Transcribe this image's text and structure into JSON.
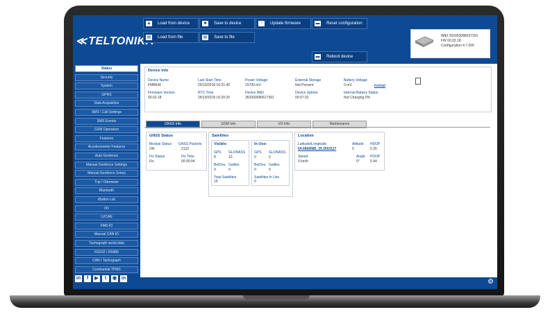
{
  "brand": {
    "name": "TELTONIKA",
    "mark": "≪"
  },
  "toolbar": {
    "load_from_device": "Load from device",
    "save_to_device": "Save to device",
    "update_firmware": "Update firmware",
    "reset_configuration": "Reset configuration",
    "load_from_file": "Load from file",
    "save_to_file": "Save to file",
    "reboot_device": "Reboot device"
  },
  "device_box": {
    "imei": "IMEI 352093088637391",
    "fw": "FW 00.02.18",
    "configuration": "Configuration 4.7.000"
  },
  "sidebar": {
    "items": [
      "Status",
      "Security",
      "System",
      "GPRS",
      "Data Acquisition",
      "SMS \\ Call Settings",
      "SMS Events",
      "GSM Operators",
      "Features",
      "Accelerometer Features",
      "Auto Geofence",
      "Manual Geofence Settings",
      "Manual Geofence Zones",
      "Trip \\ Odometer",
      "Bluetooth",
      "iButton List",
      "I/O",
      "LVCAN",
      "FMS IO",
      "Manual CAN IO",
      "Tachograph serial data",
      "RS232 \\ RS485",
      "CAN \\ Tachograph",
      "Continental TPMS"
    ],
    "social": [
      "in",
      "f",
      "▶",
      "t",
      "◉",
      "in"
    ]
  },
  "device_info": {
    "title": "Device Info",
    "fields": [
      {
        "label": "Device Name",
        "value": "FMB640"
      },
      {
        "label": "Last Start Time",
        "value": "25/10/2018 16:21:40"
      },
      {
        "label": "Power Voltage",
        "value": "15790 mV."
      },
      {
        "label": "External Storage",
        "value": "Not Present"
      },
      {
        "label": "Battery Voltage",
        "value": "0 mV."
      },
      {
        "label": "Firmware Version",
        "value": "00.02.18"
      },
      {
        "label": "RTC Time",
        "value": "25/10/2018 16:29:20"
      },
      {
        "label": "Device IMEI",
        "value": "352093080617391"
      },
      {
        "label": "Device Uptime",
        "value": "00:07:32"
      },
      {
        "label": "Internal Battery Status",
        "value": "Not Charging 0%"
      }
    ],
    "format_link": "Format"
  },
  "tabs": [
    "GNSS Info",
    "GSM Info",
    "I/O Info",
    "Maintenance"
  ],
  "gnss_status": {
    "title": "GNSS Status",
    "module_status_label": "Module Status",
    "module_status": "ON",
    "gnss_packets_label": "GNSS Packets",
    "gnss_packets": "2132",
    "fix_status_label": "Fix Status",
    "fix_status": "Fix",
    "fix_time_label": "Fix Time",
    "fix_time": "00:00:04"
  },
  "satellites": {
    "title": "Satellites",
    "visible_title": "Visible:",
    "in_use_title": "In Use:",
    "gps_label": "GPS",
    "glonass_label": "GLONASS",
    "beidou_label": "BeiDou",
    "galileo_label": "Galileo",
    "visible": {
      "gps": "8",
      "glonass": "10",
      "beidou": "0",
      "galileo": "0"
    },
    "in_use": {
      "gps": "0",
      "glonass": "0",
      "beidou": "0",
      "galileo": "0"
    },
    "total_label": "Total Satellites",
    "total": "15",
    "sats_in_use_label": "Satellites In Use",
    "sats_in_use": "0"
  },
  "location": {
    "title": "Location",
    "latlng_label": "Latitude/Longitude",
    "latlng": "54.6669585, 25.2553117",
    "altitude_label": "Altitude",
    "altitude": "0",
    "hdop_label": "HDOP",
    "hdop": "5.35",
    "speed_label": "Speed",
    "speed": "0 km/h",
    "angle_label": "Angle",
    "angle": "0°",
    "pdop_label": "PDOP",
    "pdop": "5.44"
  },
  "colors": {
    "brand_blue": "#0e4a93",
    "panel_border": "#c7cfda"
  }
}
